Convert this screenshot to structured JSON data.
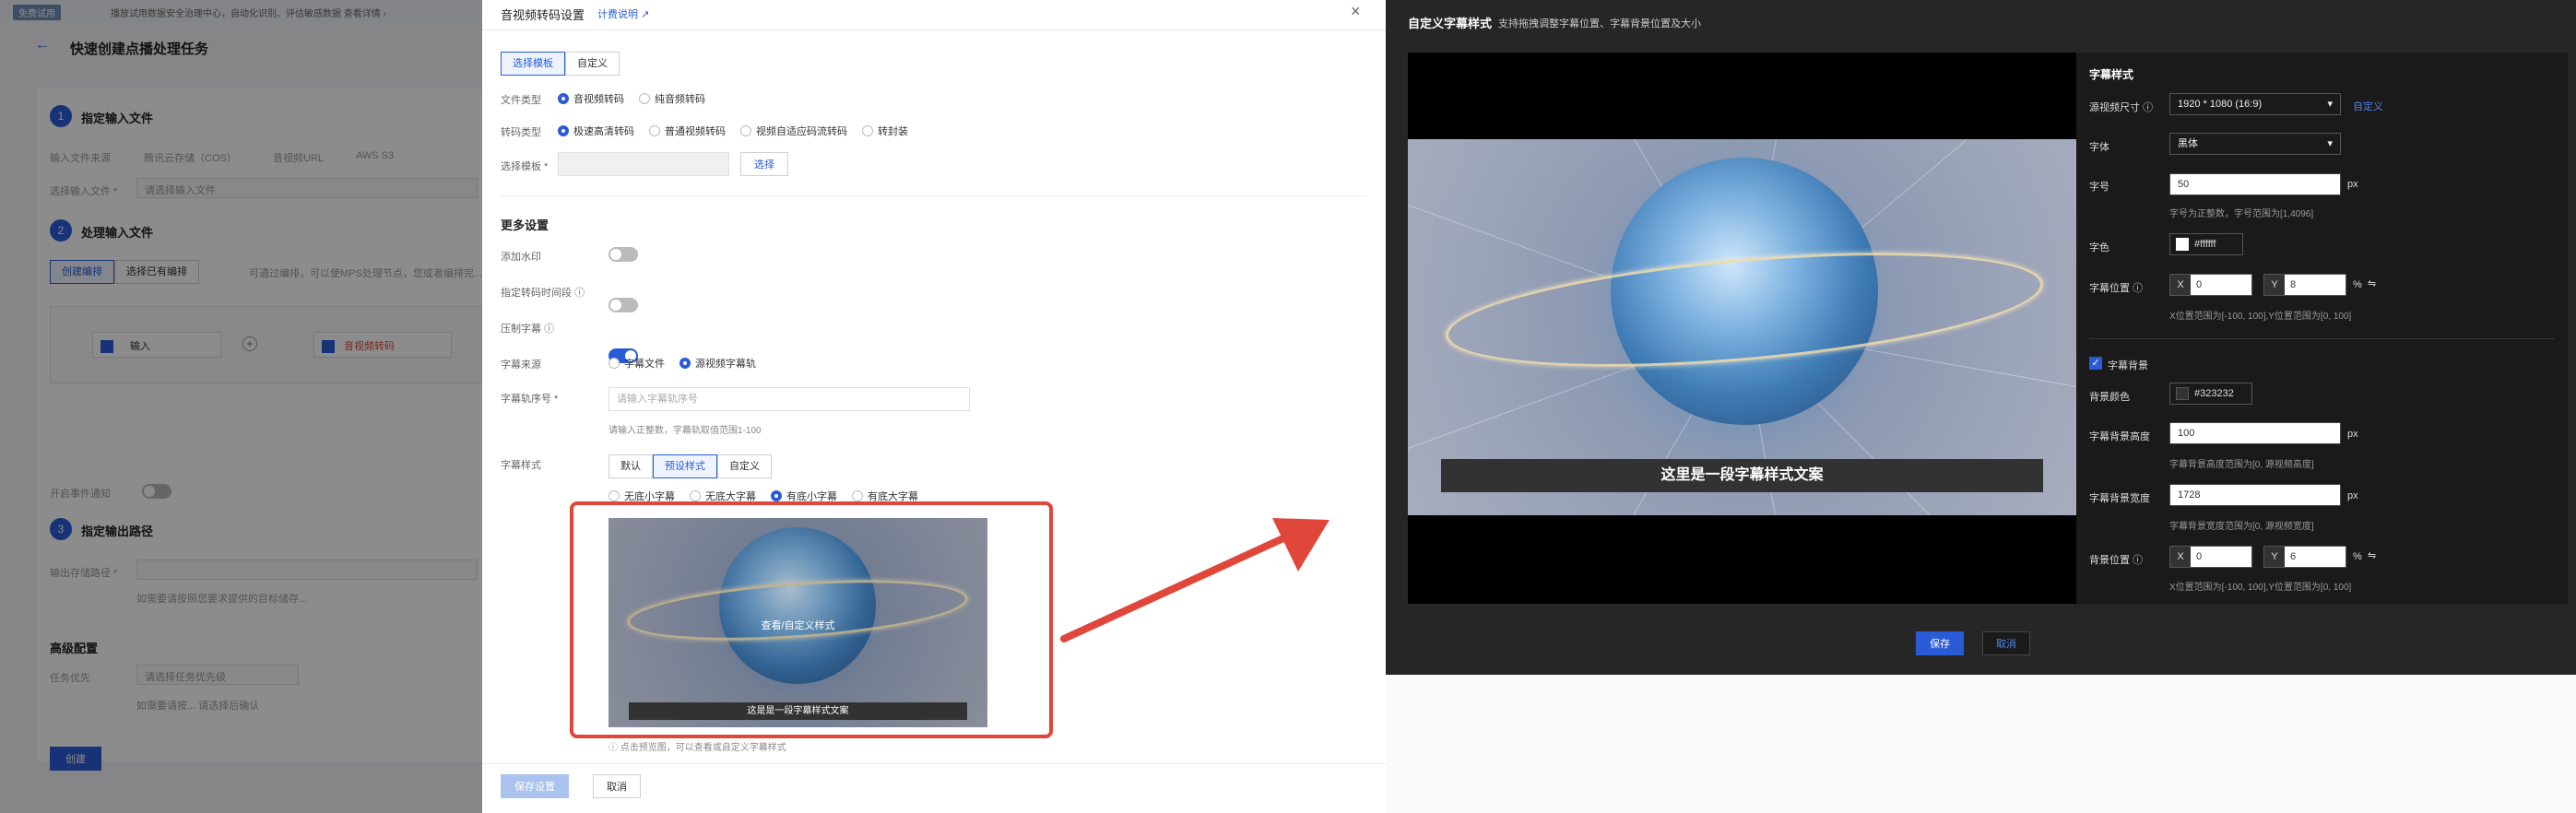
{
  "background_page": {
    "badge": "免费试用",
    "notice": "播放试用数据安全治理中心，自动化识别、评估敏感数据   查看详情 ›",
    "back_icon": "arrow-left-icon",
    "title": "快速创建点播处理任务",
    "steps": [
      {
        "num": "1",
        "label": "指定输入文件"
      },
      {
        "num": "2",
        "label": "处理输入文件"
      },
      {
        "num": "3",
        "label": "指定输出路径"
      }
    ],
    "input_source_label": "输入文件来源",
    "input_sources": [
      "腾讯云存储（COS）",
      "音视频URL",
      "AWS S3"
    ],
    "input_file_label": "选择输入文件 *",
    "input_file_placeholder": "请选择输入文件",
    "process_tabs": [
      "创建编排",
      "选择已有编排"
    ],
    "process_hint": "可通过编排，可以使MPS处理节点，您或者编排完...",
    "node_input": "输入",
    "node_transcode": "音视频转码",
    "output_switch_label": "开启事件通知",
    "output_path_label": "输出存储路径 *",
    "output_hint": "如需要请按照您要求提供的目标储存...",
    "advanced_title": "高级配置",
    "priority_label": "任务优先",
    "priority_placeholder": "请选择任务优先级",
    "priority_hint": "如需要请按... 请选择后确认",
    "create_button": "创建"
  },
  "drawer": {
    "title": "音视频转码设置",
    "pricing_link": "计费说明",
    "template_tabs": [
      "选择模板",
      "自定义"
    ],
    "file_type_label": "文件类型",
    "file_types": [
      {
        "label": "音视频转码",
        "checked": true
      },
      {
        "label": "纯音频转码",
        "checked": false
      }
    ],
    "transcode_type_label": "转码类型",
    "transcode_types": [
      {
        "label": "极速高清转码",
        "checked": true
      },
      {
        "label": "普通视频转码",
        "checked": false
      },
      {
        "label": "视频自适应码流转码",
        "checked": false
      },
      {
        "label": "转封装",
        "checked": false
      }
    ],
    "template_label": "选择模板 *",
    "select_button": "选择",
    "more_settings": "更多设置",
    "watermark_label": "添加水印",
    "watermark_on": false,
    "clip_label": "指定转码时间段",
    "clip_on": false,
    "subtitle_burn_label": "压制字幕",
    "subtitle_burn_on": true,
    "subtitle_source_label": "字幕来源",
    "subtitle_sources": [
      {
        "label": "字幕文件",
        "checked": false
      },
      {
        "label": "源视频字幕轨",
        "checked": true
      }
    ],
    "track_label": "字幕轨序号 *",
    "track_placeholder": "请输入字幕轨序号",
    "track_hint": "请输入正整数，字幕轨取值范围1-100",
    "style_label": "字幕样式",
    "style_tabs": [
      "默认",
      "预设样式",
      "自定义"
    ],
    "style_presets": [
      {
        "label": "无底小字幕",
        "checked": false
      },
      {
        "label": "无底大字幕",
        "checked": false
      },
      {
        "label": "有底小字幕",
        "checked": true
      },
      {
        "label": "有底大字幕",
        "checked": false
      }
    ],
    "preview_overlay": "查看/自定义样式",
    "preview_subtitle": "这是是一段字幕样式文案",
    "preview_hint": "点击预览图，可以查看或自定义字幕样式",
    "save_button": "保存设置",
    "cancel_button": "取消"
  },
  "modal": {
    "title": "自定义字幕样式",
    "subtitle": "支持拖拽调整字幕位置、字幕背景位置及大小",
    "preview_subtitle": "这里是一段字幕样式文案",
    "section_title": "字幕样式",
    "size_label": "源视频尺寸",
    "size_value": "1920 * 1080 (16:9)",
    "size_link": "自定义",
    "font_label": "字体",
    "font_value": "黑体",
    "fontsize_label": "字号",
    "fontsize_value": "50",
    "fontsize_unit": "px",
    "fontsize_hint": "字号为正整数，字号范围为[1,4096]",
    "color_label": "字色",
    "color_value": "#ffffff",
    "position_label": "字幕位置",
    "position_x": "0",
    "position_y": "8",
    "position_unit": "%",
    "position_hint": "X位置范围为[-100, 100],Y位置范围为[0, 100]",
    "bg_checkbox_label": "字幕背景",
    "bg_checked": true,
    "bg_color_label": "背景颜色",
    "bg_color_value": "#323232",
    "bg_height_label": "字幕背景高度",
    "bg_height_value": "100",
    "bg_height_unit": "px",
    "bg_height_hint": "字幕背景高度范围为[0, 源视频高度]",
    "bg_width_label": "字幕背景宽度",
    "bg_width_value": "1728",
    "bg_width_unit": "px",
    "bg_width_hint": "字幕背景宽度范围为[0, 源视频宽度]",
    "bg_position_label": "背景位置",
    "bg_position_x": "0",
    "bg_position_y": "6",
    "bg_position_unit": "%",
    "bg_position_hint": "X位置范围为[-100, 100],Y位置范围为[0, 100]",
    "save_button": "保存",
    "cancel_button": "取消"
  },
  "axis_labels": {
    "x": "X",
    "y": "Y"
  },
  "colors": {
    "accent": "#2a5bd7",
    "annotation_red": "#e0463a",
    "modal_bg": "#262626",
    "subtitle_bg": "#323232"
  }
}
